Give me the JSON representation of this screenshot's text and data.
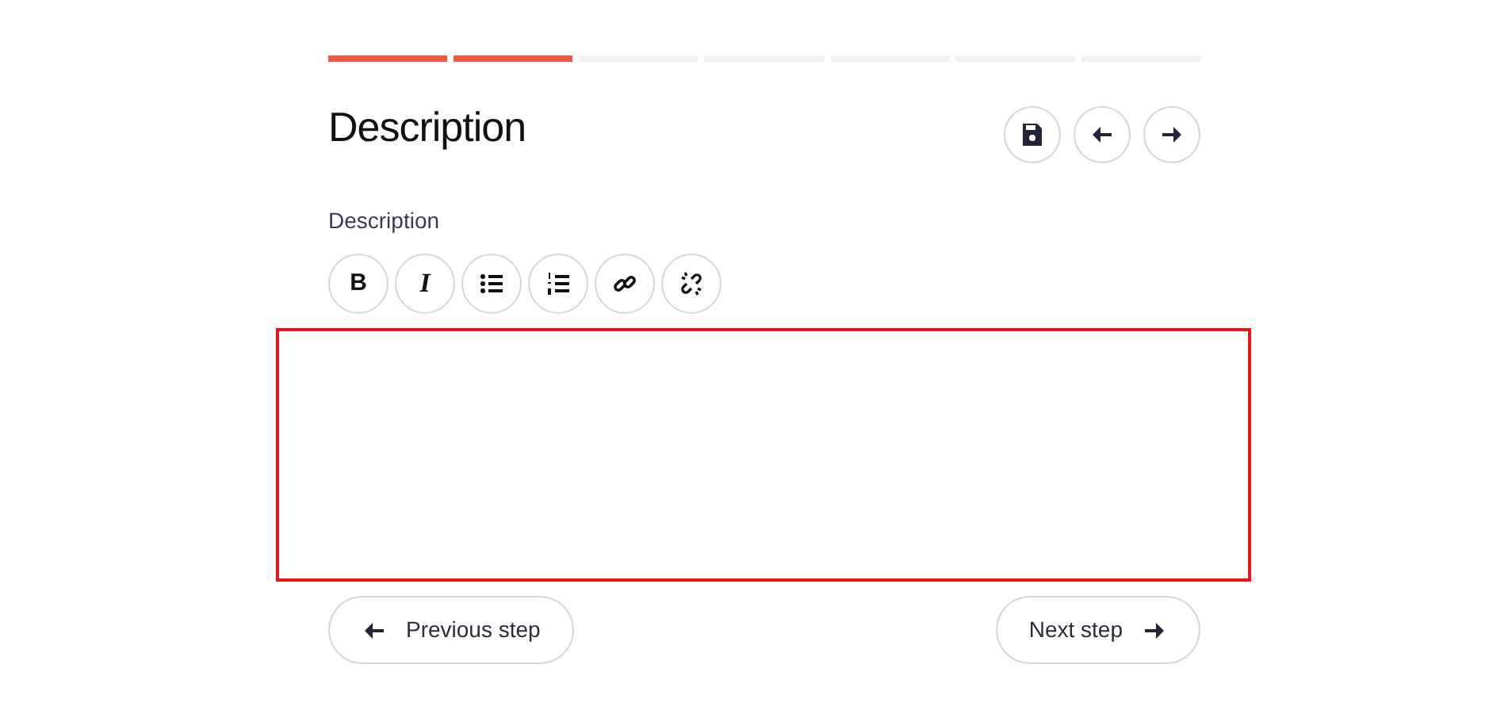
{
  "progress": [
    {
      "done": true
    },
    {
      "done": true
    },
    {
      "done": false
    },
    {
      "done": false
    },
    {
      "done": false
    },
    {
      "done": false
    },
    {
      "done": false
    }
  ],
  "title": "Description",
  "header_buttons": [
    {
      "kind": "save"
    },
    {
      "kind": "back"
    },
    {
      "kind": "forward"
    }
  ],
  "field_label": "Description",
  "toolbar": [
    {
      "kind": "bold",
      "label": "B"
    },
    {
      "kind": "italic",
      "label": "I"
    },
    {
      "kind": "bullets"
    },
    {
      "kind": "numbers"
    },
    {
      "kind": "link"
    },
    {
      "kind": "unlink"
    }
  ],
  "editor": {
    "invalid": true
  },
  "previous_button": "Previous step",
  "next_button": "Next step"
}
